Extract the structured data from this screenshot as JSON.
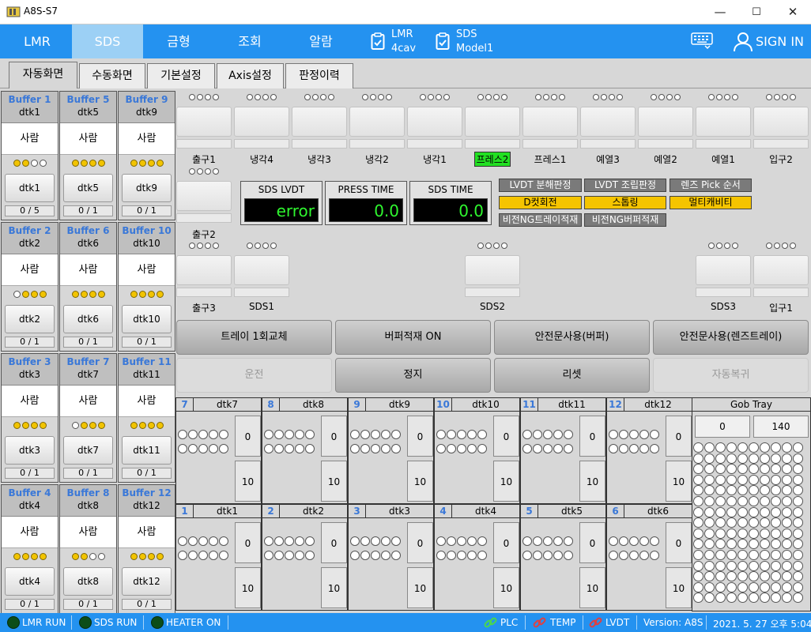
{
  "window": {
    "title": "A8S-S7",
    "min": "—",
    "max": "☐",
    "close": "✕"
  },
  "nav": {
    "items": [
      "LMR",
      "SDS",
      "금형",
      "조회",
      "알람"
    ],
    "active_index": 1,
    "lmr_info": {
      "line1": "LMR",
      "line2": "4cav"
    },
    "sds_info": {
      "line1": "SDS",
      "line2": "Model1"
    },
    "sign_in": "SIGN IN"
  },
  "tabs": [
    "자동화면",
    "수동화면",
    "기본설정",
    "Axis설정",
    "판정이력"
  ],
  "buffers": [
    {
      "name": "Buffer 1",
      "dtk": "dtk1",
      "state": "사람",
      "dots": [
        1,
        1,
        0,
        0
      ],
      "btn": "dtk1",
      "count": "0 / 5"
    },
    {
      "name": "Buffer 5",
      "dtk": "dtk5",
      "state": "사람",
      "dots": [
        1,
        1,
        1,
        1
      ],
      "btn": "dtk5",
      "count": "0 / 1"
    },
    {
      "name": "Buffer 9",
      "dtk": "dtk9",
      "state": "사람",
      "dots": [
        1,
        1,
        1,
        1
      ],
      "btn": "dtk9",
      "count": "0 / 1"
    },
    {
      "name": "Buffer 2",
      "dtk": "dtk2",
      "state": "사람",
      "dots": [
        0,
        1,
        1,
        1
      ],
      "btn": "dtk2",
      "count": "0 / 1"
    },
    {
      "name": "Buffer 6",
      "dtk": "dtk6",
      "state": "사람",
      "dots": [
        1,
        1,
        1,
        1
      ],
      "btn": "dtk6",
      "count": "0 / 1"
    },
    {
      "name": "Buffer 10",
      "dtk": "dtk10",
      "state": "사람",
      "dots": [
        1,
        1,
        1,
        1
      ],
      "btn": "dtk10",
      "count": "0 / 1"
    },
    {
      "name": "Buffer 3",
      "dtk": "dtk3",
      "state": "사람",
      "dots": [
        1,
        1,
        1,
        1
      ],
      "btn": "dtk3",
      "count": "0 / 1"
    },
    {
      "name": "Buffer 7",
      "dtk": "dtk7",
      "state": "사람",
      "dots": [
        0,
        1,
        1,
        1
      ],
      "btn": "dtk7",
      "count": "0 / 1"
    },
    {
      "name": "Buffer 11",
      "dtk": "dtk11",
      "state": "사람",
      "dots": [
        1,
        1,
        1,
        1
      ],
      "btn": "dtk11",
      "count": "0 / 1"
    },
    {
      "name": "Buffer 4",
      "dtk": "dtk4",
      "state": "사람",
      "dots": [
        1,
        1,
        1,
        1
      ],
      "btn": "dtk4",
      "count": "0 / 1"
    },
    {
      "name": "Buffer 8",
      "dtk": "dtk8",
      "state": "사람",
      "dots": [
        1,
        1,
        0,
        0
      ],
      "btn": "dtk8",
      "count": "0 / 1"
    },
    {
      "name": "Buffer 12",
      "dtk": "dtk12",
      "state": "사람",
      "dots": [
        1,
        1,
        1,
        1
      ],
      "btn": "dtk12",
      "count": "0 / 1"
    }
  ],
  "stations_top": [
    "출구1",
    "냉각4",
    "냉각3",
    "냉각2",
    "냉각1",
    "프레스2",
    "프레스1",
    "예열3",
    "예열2",
    "예열1",
    "입구2"
  ],
  "stations_mid": [
    "출구2"
  ],
  "stations_low": [
    "출구3",
    "SDS1",
    "SDS2",
    "SDS3",
    "입구1"
  ],
  "highlight_station": "프레스2",
  "displays": [
    {
      "label": "SDS LVDT",
      "value": "error"
    },
    {
      "label": "PRESS TIME",
      "value": "0.0"
    },
    {
      "label": "SDS TIME",
      "value": "0.0"
    }
  ],
  "tags": [
    {
      "text": "LVDT 분해판정",
      "on": false
    },
    {
      "text": "LVDT 조립판정",
      "on": false
    },
    {
      "text": "렌즈 Pick 순서",
      "on": false
    },
    {
      "text": "D컷회전",
      "on": true
    },
    {
      "text": "스톱링",
      "on": true
    },
    {
      "text": "멀티캐비티",
      "on": true
    },
    {
      "text": "비전NG트레이적재",
      "on": false
    },
    {
      "text": "비전NG버퍼적재",
      "on": false
    }
  ],
  "actions_row1": [
    "트레이 1회교체",
    "버퍼적재 ON",
    "안전문사용(버퍼)",
    "안전문사용(렌즈트레이)"
  ],
  "actions_row2": [
    {
      "label": "운전",
      "disabled": true
    },
    {
      "label": "정지",
      "disabled": false
    },
    {
      "label": "리셋",
      "disabled": false
    },
    {
      "label": "자동복귀",
      "disabled": true
    }
  ],
  "grid_top": [
    {
      "num": "7",
      "name": "dtk7",
      "top": "0",
      "bottom": "10"
    },
    {
      "num": "8",
      "name": "dtk8",
      "top": "0",
      "bottom": "10"
    },
    {
      "num": "9",
      "name": "dtk9",
      "top": "0",
      "bottom": "10"
    },
    {
      "num": "10",
      "name": "dtk10",
      "top": "0",
      "bottom": "10"
    },
    {
      "num": "11",
      "name": "dtk11",
      "top": "0",
      "bottom": "10"
    },
    {
      "num": "12",
      "name": "dtk12",
      "top": "0",
      "bottom": "10"
    }
  ],
  "grid_bottom": [
    {
      "num": "1",
      "name": "dtk1",
      "top": "0",
      "bottom": "10"
    },
    {
      "num": "2",
      "name": "dtk2",
      "top": "0",
      "bottom": "10"
    },
    {
      "num": "3",
      "name": "dtk3",
      "top": "0",
      "bottom": "10"
    },
    {
      "num": "4",
      "name": "dtk4",
      "top": "0",
      "bottom": "10"
    },
    {
      "num": "5",
      "name": "dtk5",
      "top": "0",
      "bottom": "10"
    },
    {
      "num": "6",
      "name": "dtk6",
      "top": "0",
      "bottom": "10"
    }
  ],
  "gob": {
    "title": "Gob Tray",
    "left": "0",
    "right": "140"
  },
  "status": {
    "lmr_run": "LMR RUN",
    "sds_run": "SDS RUN",
    "heater_on": "HEATER ON",
    "plc": "PLC",
    "temp": "TEMP",
    "lvdt": "LVDT",
    "version": "Version: A8S",
    "datetime": "2021. 5. 27 오후 5:04"
  },
  "colors": {
    "accent": "#2492f0",
    "nav_active": "#9cd0f5",
    "yellow": "#f5c400",
    "highlight_green": "#22e022",
    "led_green": "#0c4d18",
    "link_red": "#e04040",
    "link_green": "#4bd84b"
  }
}
